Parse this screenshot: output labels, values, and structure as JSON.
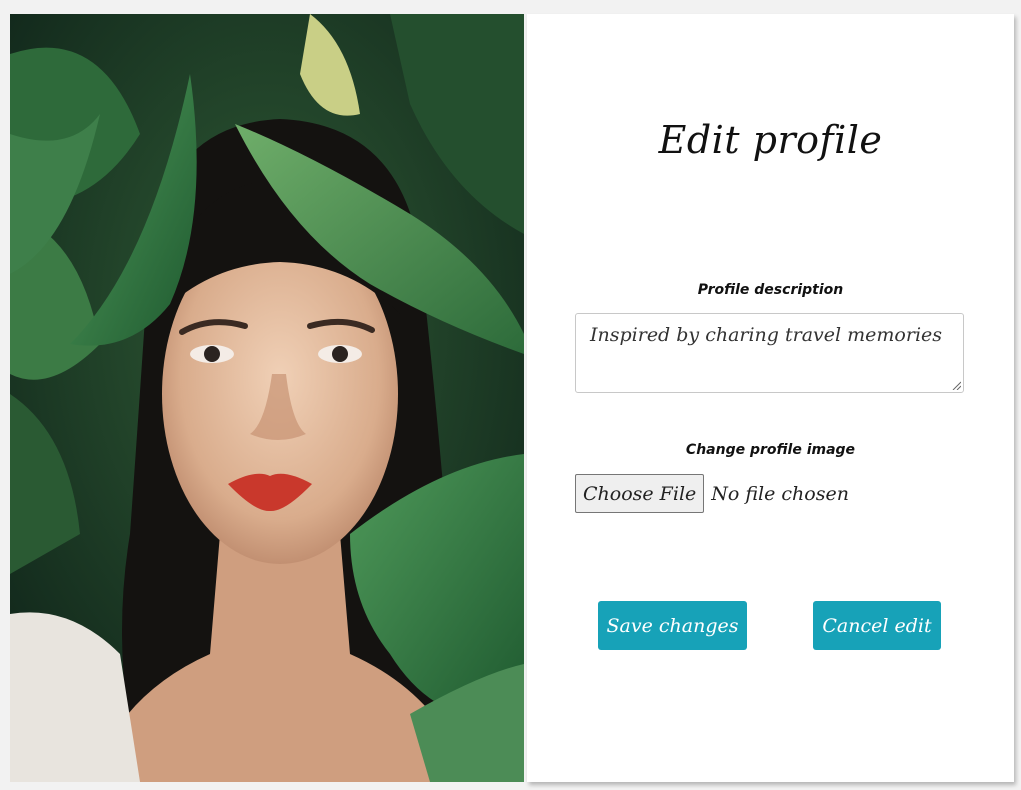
{
  "form": {
    "title": "Edit profile",
    "description_label": "Profile description",
    "description_value": "Inspired by charing travel memories",
    "image_label": "Change profile image",
    "file_button_label": "Choose File",
    "file_status": "No file chosen",
    "save_label": "Save changes",
    "cancel_label": "Cancel edit"
  },
  "colors": {
    "accent": "#17a2b8",
    "card": "#ffffff",
    "background": "#f2f2f2"
  }
}
